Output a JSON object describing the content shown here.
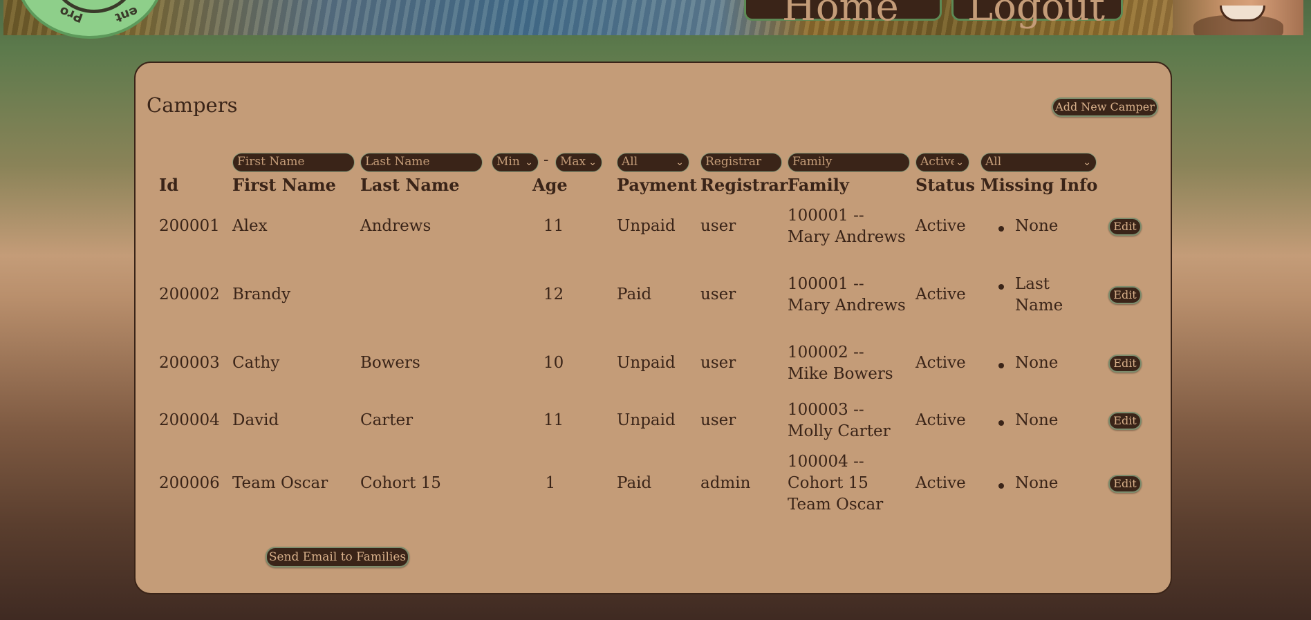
{
  "header": {
    "logo_text_left": "Pro",
    "logo_text_right": "ent",
    "home_label": "Home",
    "logout_label": "Logout"
  },
  "page": {
    "title": "Campers",
    "add_button": "Add New Camper",
    "email_button": "Send Email to Families"
  },
  "filters": {
    "first_name_placeholder": "First Name",
    "last_name_placeholder": "Last Name",
    "age_min": "Min",
    "age_separator": "-",
    "age_max": "Max",
    "payment": "All",
    "registrar_placeholder": "Registrar",
    "family_placeholder": "Family",
    "status": "Active",
    "missing_info": "All"
  },
  "columns": {
    "id": "Id",
    "first_name": "First Name",
    "last_name": "Last Name",
    "age": "Age",
    "payment": "Payment",
    "registrar": "Registrar",
    "family": "Family",
    "status": "Status",
    "missing_info": "Missing Info"
  },
  "rows": [
    {
      "id": "200001",
      "first_name": "Alex",
      "last_name": "Andrews",
      "age": "11",
      "payment": "Unpaid",
      "registrar": "user",
      "family_l1": "100001 --",
      "family_l2": "Mary Andrews",
      "family_l3": "",
      "status": "Active",
      "missing_l1": "None",
      "missing_l2": "",
      "edit": "Edit"
    },
    {
      "id": "200002",
      "first_name": "Brandy",
      "last_name": "",
      "age": "12",
      "payment": "Paid",
      "registrar": "user",
      "family_l1": "100001 --",
      "family_l2": "Mary Andrews",
      "family_l3": "",
      "status": "Active",
      "missing_l1": "Last",
      "missing_l2": "Name",
      "edit": "Edit"
    },
    {
      "id": "200003",
      "first_name": "Cathy",
      "last_name": "Bowers",
      "age": "10",
      "payment": "Unpaid",
      "registrar": "user",
      "family_l1": "100002 --",
      "family_l2": "Mike Bowers",
      "family_l3": "",
      "status": "Active",
      "missing_l1": "None",
      "missing_l2": "",
      "edit": "Edit"
    },
    {
      "id": "200004",
      "first_name": "David",
      "last_name": "Carter",
      "age": "11",
      "payment": "Unpaid",
      "registrar": "user",
      "family_l1": "100003 --",
      "family_l2": "Molly Carter",
      "family_l3": "",
      "status": "Active",
      "missing_l1": "None",
      "missing_l2": "",
      "edit": "Edit"
    },
    {
      "id": "200006",
      "first_name": "Team Oscar",
      "last_name": "Cohort 15",
      "age": "1",
      "payment": "Paid",
      "registrar": "admin",
      "family_l1": "100004 --",
      "family_l2": "Cohort 15",
      "family_l3": "Team Oscar",
      "status": "Active",
      "missing_l1": "None",
      "missing_l2": "",
      "edit": "Edit"
    }
  ],
  "colors": {
    "panel": "#c49c78",
    "button_bg": "#3a2418",
    "text": "#3a2418"
  }
}
